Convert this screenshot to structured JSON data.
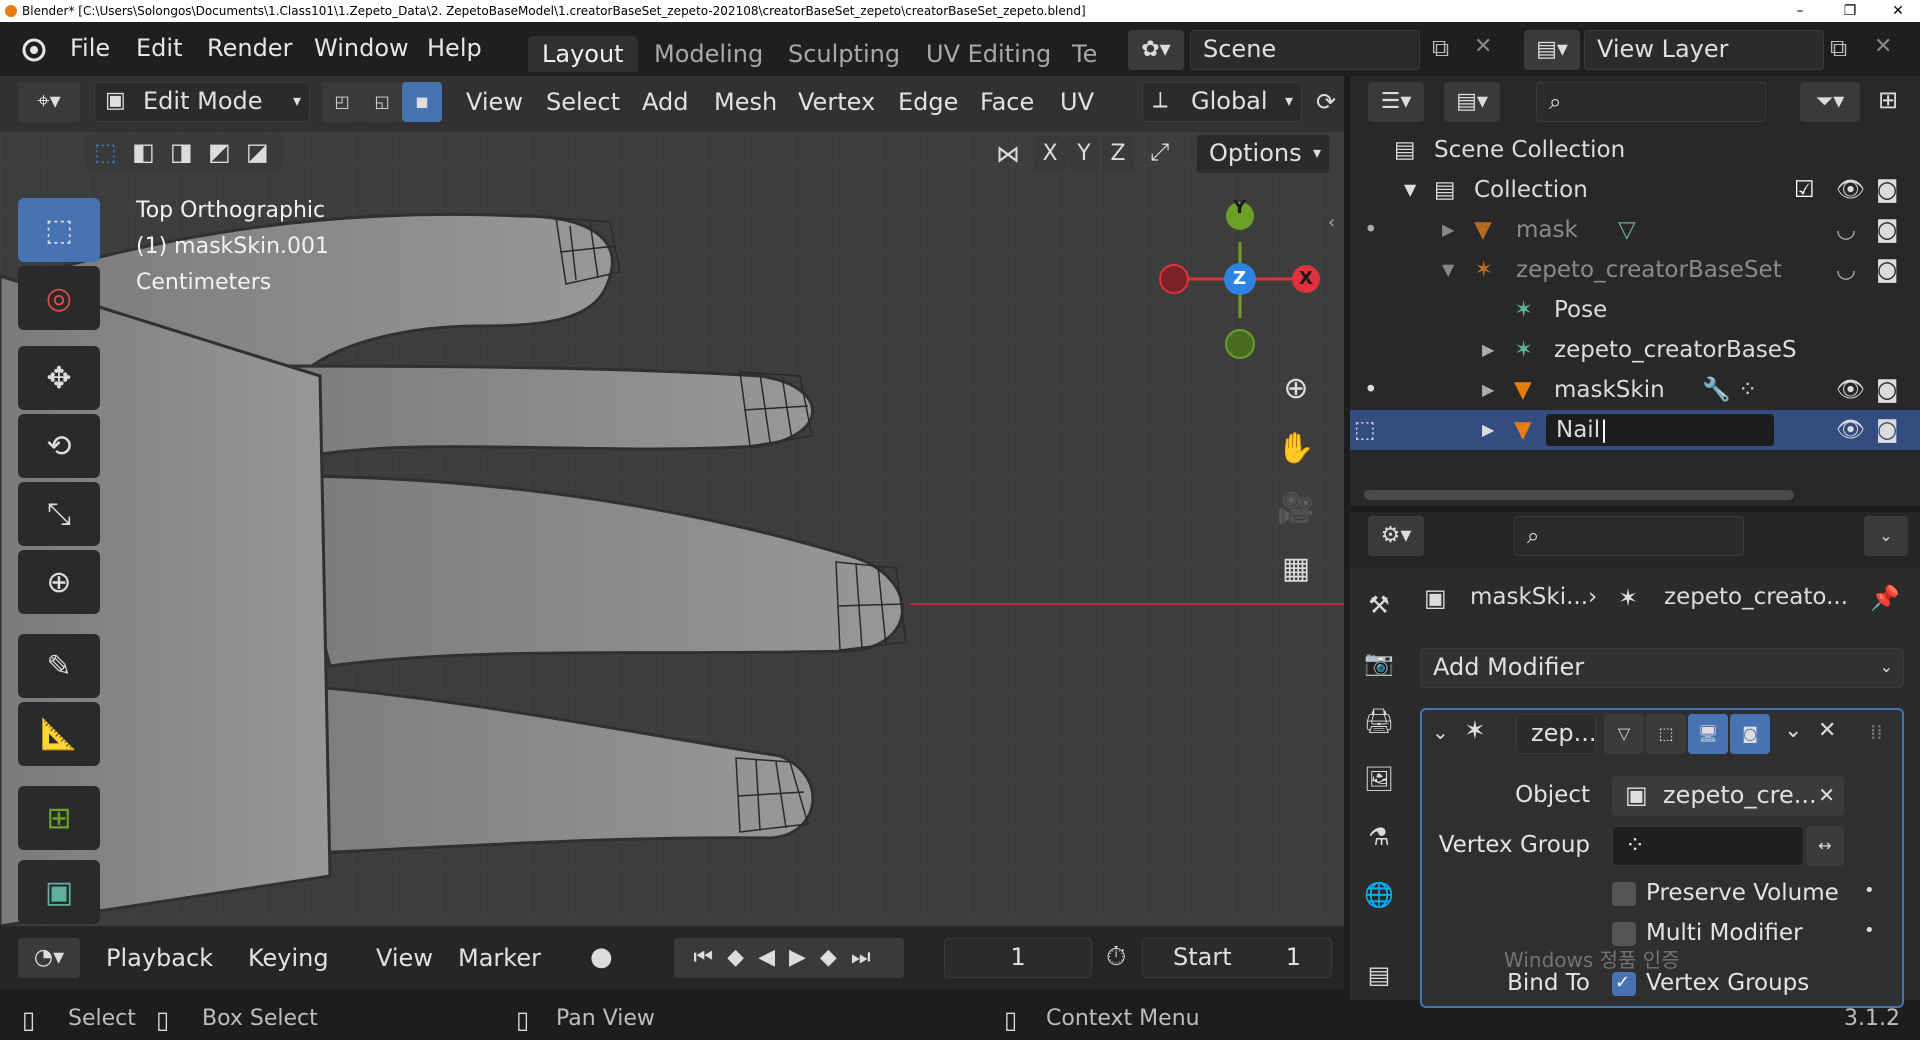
{
  "window": {
    "title": "Blender* [C:\\Users\\Solongos\\Documents\\1.Class101\\1.Zepeto_Data\\2. ZepetoBaseModel\\1.creatorBaseSet_zepeto-202108\\creatorBaseSet_zepeto\\creatorBaseSet_zepeto.blend]"
  },
  "menubar": {
    "items": [
      "File",
      "Edit",
      "Render",
      "Window",
      "Help"
    ]
  },
  "workspaces": {
    "tabs": [
      "Layout",
      "Modeling",
      "Sculpting",
      "UV Editing",
      "Te"
    ],
    "active": "Layout"
  },
  "scene": {
    "name": "Scene"
  },
  "view_layer": {
    "name": "View Layer"
  },
  "viewport_header": {
    "mode": "Edit Mode",
    "menus": [
      "View",
      "Select",
      "Add",
      "Mesh",
      "Vertex",
      "Edge",
      "Face",
      "UV"
    ],
    "transform_orientation": "Global",
    "axes": [
      "X",
      "Y",
      "Z"
    ],
    "options_label": "Options"
  },
  "viewport": {
    "view_name": "Top Orthographic",
    "object_info": "(1) maskSkin.001",
    "units": "Centimeters",
    "gizmo": {
      "x": "X",
      "y": "Y",
      "z": "Z"
    }
  },
  "outliner": {
    "scene_collection": "Scene Collection",
    "rows": [
      {
        "label": "Collection"
      },
      {
        "label": "mask"
      },
      {
        "label": "zepeto_creatorBaseSet"
      },
      {
        "label": "Pose"
      },
      {
        "label": "zepeto_creatorBaseS"
      },
      {
        "label": "maskSkin"
      },
      {
        "label": "Nail"
      }
    ]
  },
  "properties": {
    "breadcrumb": [
      "maskSki...",
      "zepeto_creato..."
    ],
    "add_modifier": "Add Modifier",
    "modifier": {
      "name": "zep...",
      "object_label": "Object",
      "object_value": "zepeto_cre...",
      "vertex_group_label": "Vertex Group",
      "preserve_volume": "Preserve Volume",
      "multi_modifier": "Multi Modifier",
      "bind_to_label": "Bind To",
      "vertex_groups": "Vertex Groups"
    },
    "watermark": "Windows 정품 인증"
  },
  "timeline": {
    "menus": [
      "Playback",
      "Keying",
      "View",
      "Marker"
    ],
    "current_frame": "1",
    "start_label": "Start",
    "start_value": "1"
  },
  "statusbar": {
    "items": [
      "Select",
      "Box Select",
      "Pan View",
      "Context Menu"
    ],
    "version": "3.1.2"
  },
  "colors": {
    "accent": "#4772b3",
    "x_axis": "#e0323e",
    "y_axis": "#6ba126",
    "z_axis": "#2f83e0",
    "object_orange": "#e87d0d"
  }
}
